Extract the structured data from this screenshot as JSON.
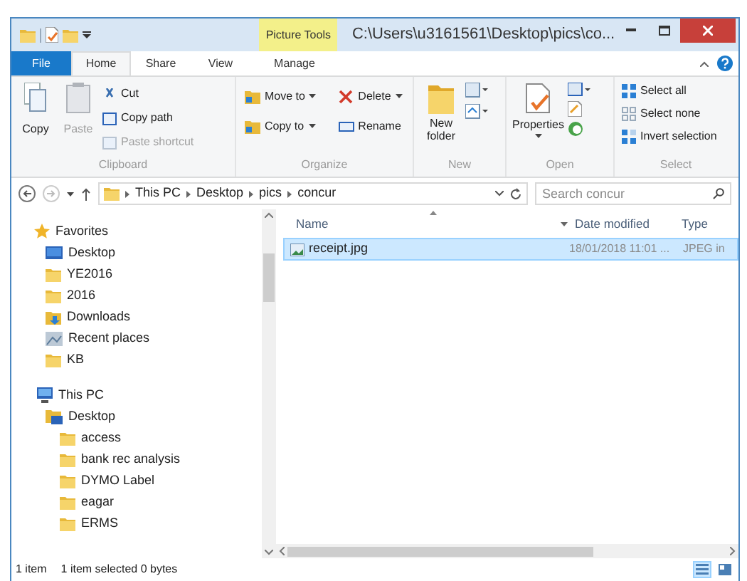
{
  "window": {
    "title": "C:\\Users\\u3161561\\Desktop\\pics\\co...",
    "contextual_tab": "Picture Tools"
  },
  "tabs": [
    {
      "label": "File",
      "kind": "file",
      "selected": false
    },
    {
      "label": "Home",
      "kind": "tab",
      "selected": true
    },
    {
      "label": "Share",
      "kind": "tab",
      "selected": false
    },
    {
      "label": "View",
      "kind": "tab",
      "selected": false
    },
    {
      "label": "Manage",
      "kind": "tab",
      "selected": false
    }
  ],
  "ribbon": {
    "clipboard": {
      "label": "Clipboard",
      "copy": {
        "label": "Copy",
        "disabled": false
      },
      "paste": {
        "label": "Paste",
        "disabled": true
      },
      "cut": {
        "label": "Cut",
        "disabled": false
      },
      "copy_path": {
        "label": "Copy path",
        "disabled": false
      },
      "paste_shortcut": {
        "label": "Paste shortcut",
        "disabled": true
      }
    },
    "organize": {
      "label": "Organize",
      "move_to": "Move to",
      "delete": "Delete",
      "copy_to": "Copy to",
      "rename": "Rename"
    },
    "new": {
      "label": "New",
      "new_folder": "New folder"
    },
    "open": {
      "label": "Open",
      "properties": "Properties"
    },
    "select": {
      "label": "Select",
      "select_all": "Select all",
      "select_none": "Select none",
      "invert_selection": "Invert selection"
    }
  },
  "address": {
    "crumbs": [
      "This PC",
      "Desktop",
      "pics",
      "concur"
    ],
    "search": {
      "placeholder": "Search concur"
    }
  },
  "nav": [
    {
      "label": "Favorites",
      "kind": "star",
      "children": [
        {
          "label": "Desktop",
          "kind": "desktop"
        },
        {
          "label": "YE2016",
          "kind": "folder"
        },
        {
          "label": "2016",
          "kind": "folder"
        },
        {
          "label": "Downloads",
          "kind": "downloads"
        },
        {
          "label": "Recent places",
          "kind": "recent"
        },
        {
          "label": "KB",
          "kind": "folder"
        }
      ]
    },
    {
      "label": "This PC",
      "kind": "pc",
      "children": [
        {
          "label": "Desktop",
          "kind": "desktop-folder",
          "children": [
            {
              "label": "access",
              "kind": "folder"
            },
            {
              "label": "bank rec analysis",
              "kind": "folder"
            },
            {
              "label": "DYMO Label",
              "kind": "folder"
            },
            {
              "label": "eagar",
              "kind": "folder"
            },
            {
              "label": "ERMS",
              "kind": "folder"
            }
          ]
        }
      ]
    }
  ],
  "columns": [
    "Name",
    "Date modified",
    "Type"
  ],
  "files": [
    {
      "name": "receipt.jpg",
      "date": "18/01/2018 11:01 ...",
      "type": "JPEG in",
      "selected": true
    }
  ],
  "status_bar": [
    "1 item",
    "1 item selected 0 bytes"
  ],
  "views": [
    {
      "kind": "details",
      "selected": true
    },
    {
      "kind": "large-icons",
      "selected": false
    }
  ]
}
